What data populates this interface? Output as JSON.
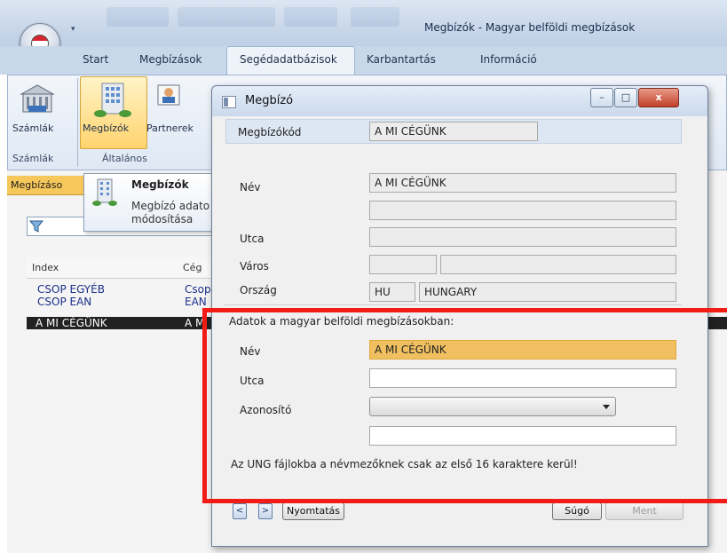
{
  "window": {
    "title": "Megbízók - Magyar belföldi megbízások"
  },
  "tabs": [
    "Start",
    "Megbízások",
    "Segédadatbázisok",
    "Karbantartás",
    "Információ"
  ],
  "ribbon": {
    "buttons": {
      "szamlak": "Számlák",
      "megbizok": "Megbízók",
      "partnerek": "Partnerek"
    },
    "groups": {
      "szamlak": "Számlák",
      "altalanos": "Általános"
    }
  },
  "list": {
    "tab_label": "Megbízáso",
    "columns": {
      "index": "Index",
      "ceg": "Cég"
    },
    "rows": [
      {
        "index": "CSOP EGYÉB",
        "ceg": "Csop"
      },
      {
        "index": "CSOP EAN",
        "ceg": "EAN"
      },
      {
        "index": "A MI CÉGÜNK",
        "ceg": "A M"
      }
    ]
  },
  "tooltip": {
    "title": "Megbízók",
    "line1": "Megbízó adato",
    "line2": "módosítása"
  },
  "dialog": {
    "title": "Megbízó",
    "caption_buttons": {
      "minimize": "–",
      "maximize": "□",
      "close": "x"
    },
    "code_label": "Megbízókód",
    "code_value": "A MI CÉGÜNK",
    "nev_label": "Név",
    "nev_value": "A MI CÉGÜNK",
    "nev2_value": "",
    "utca_label": "Utca",
    "utca_value": "",
    "varos_label": "Város",
    "irsz_value": "",
    "varos_value": "",
    "orszag_label": "Ország",
    "orszag_code": "HU",
    "orszag_name": "HUNGARY",
    "section_title": "Adatok a magyar belföldi megbízásokban:",
    "hu_nev_label": "Név",
    "hu_nev_value": "A MI CÉGÜNK",
    "hu_utca_label": "Utca",
    "hu_utca_value": "",
    "azonosito_label": "Azonosító",
    "azonosito_value": "",
    "azonosito_extra": "",
    "warning": "Az UNG fájlokba a névmezőknek csak az első 16 karaktere kerül!",
    "buttons": {
      "prev": "<",
      "next": ">",
      "print": "Nyomtatás",
      "help": "Súgó",
      "save": "Ment"
    }
  },
  "colors": {
    "accent_orange": "#f0c060",
    "annotation_red": "#f21b16",
    "selected_row": "#222222"
  }
}
